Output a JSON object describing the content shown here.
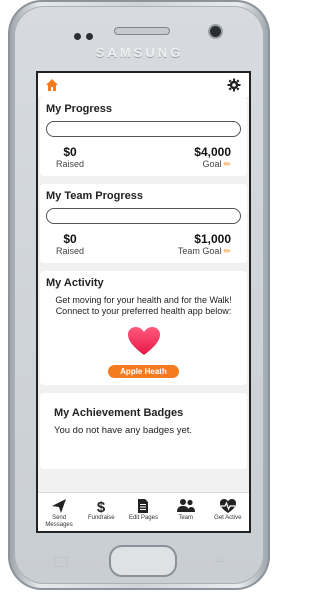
{
  "device": {
    "brand": "SAMSUNG"
  },
  "app": {
    "progress": {
      "title": "My Progress",
      "raised_amount": "$0",
      "raised_label": "Raised",
      "goal_amount": "$4,000",
      "goal_label": "Goal",
      "progress_fraction": 0
    },
    "team_progress": {
      "title": "My Team Progress",
      "raised_amount": "$0",
      "raised_label": "Raised",
      "goal_amount": "$1,000",
      "goal_label": "Team Goal",
      "progress_fraction": 0
    },
    "activity": {
      "title": "My Activity",
      "description": "Get moving for your health and for the Walk! Connect to your preferred health app below:",
      "button_label": "Apple Heath"
    },
    "badges": {
      "title": "My Achievement Badges",
      "empty_text": "You do not have any badges yet."
    },
    "nav": {
      "items": [
        {
          "label": "Send Messages",
          "icon": "send-icon"
        },
        {
          "label": "Fundraise",
          "icon": "dollar-icon"
        },
        {
          "label": "Edit Pages",
          "icon": "document-icon"
        },
        {
          "label": "Team",
          "icon": "team-icon"
        },
        {
          "label": "Get Active",
          "icon": "heartbeat-icon"
        }
      ]
    },
    "colors": {
      "accent": "#f47b20",
      "heart": "#f0305a"
    }
  }
}
